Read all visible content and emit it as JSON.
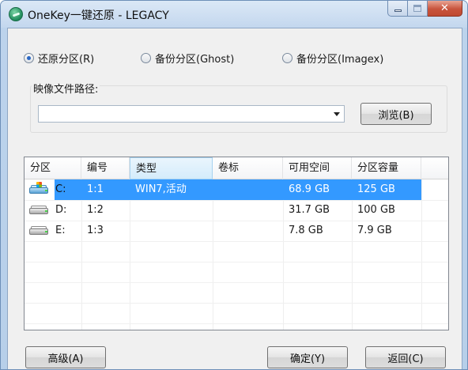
{
  "window": {
    "title": "OneKey一键还原 - LEGACY",
    "icon": "onekey-app-icon"
  },
  "mode_options": [
    {
      "label": "还原分区(R)",
      "selected": true
    },
    {
      "label": "备份分区(Ghost)",
      "selected": false
    },
    {
      "label": "备份分区(Imagex)",
      "selected": false
    }
  ],
  "image_path": {
    "label": "映像文件路径:",
    "value": "",
    "browse_label": "浏览(B)"
  },
  "table": {
    "columns": [
      "分区",
      "编号",
      "类型",
      "卷标",
      "可用空间",
      "分区容量"
    ],
    "rows": [
      {
        "drive": "C:",
        "number": "1:1",
        "type": "WIN7,活动",
        "label": "",
        "free": "68.9 GB",
        "capacity": "125 GB",
        "selected": true,
        "icon": "system-drive-icon"
      },
      {
        "drive": "D:",
        "number": "1:2",
        "type": "",
        "label": "",
        "free": "31.7 GB",
        "capacity": "100 GB",
        "selected": false,
        "icon": "hard-drive-icon"
      },
      {
        "drive": "E:",
        "number": "1:3",
        "type": "",
        "label": "",
        "free": "7.8 GB",
        "capacity": "7.9 GB",
        "selected": false,
        "icon": "hard-drive-icon"
      }
    ]
  },
  "buttons": {
    "advanced": "高级(A)",
    "ok": "确定(Y)",
    "back": "返回(C)"
  },
  "colors": {
    "selection": "#3399ff",
    "title_bar": "#c3d7ee",
    "close_button": "#c8533c"
  }
}
